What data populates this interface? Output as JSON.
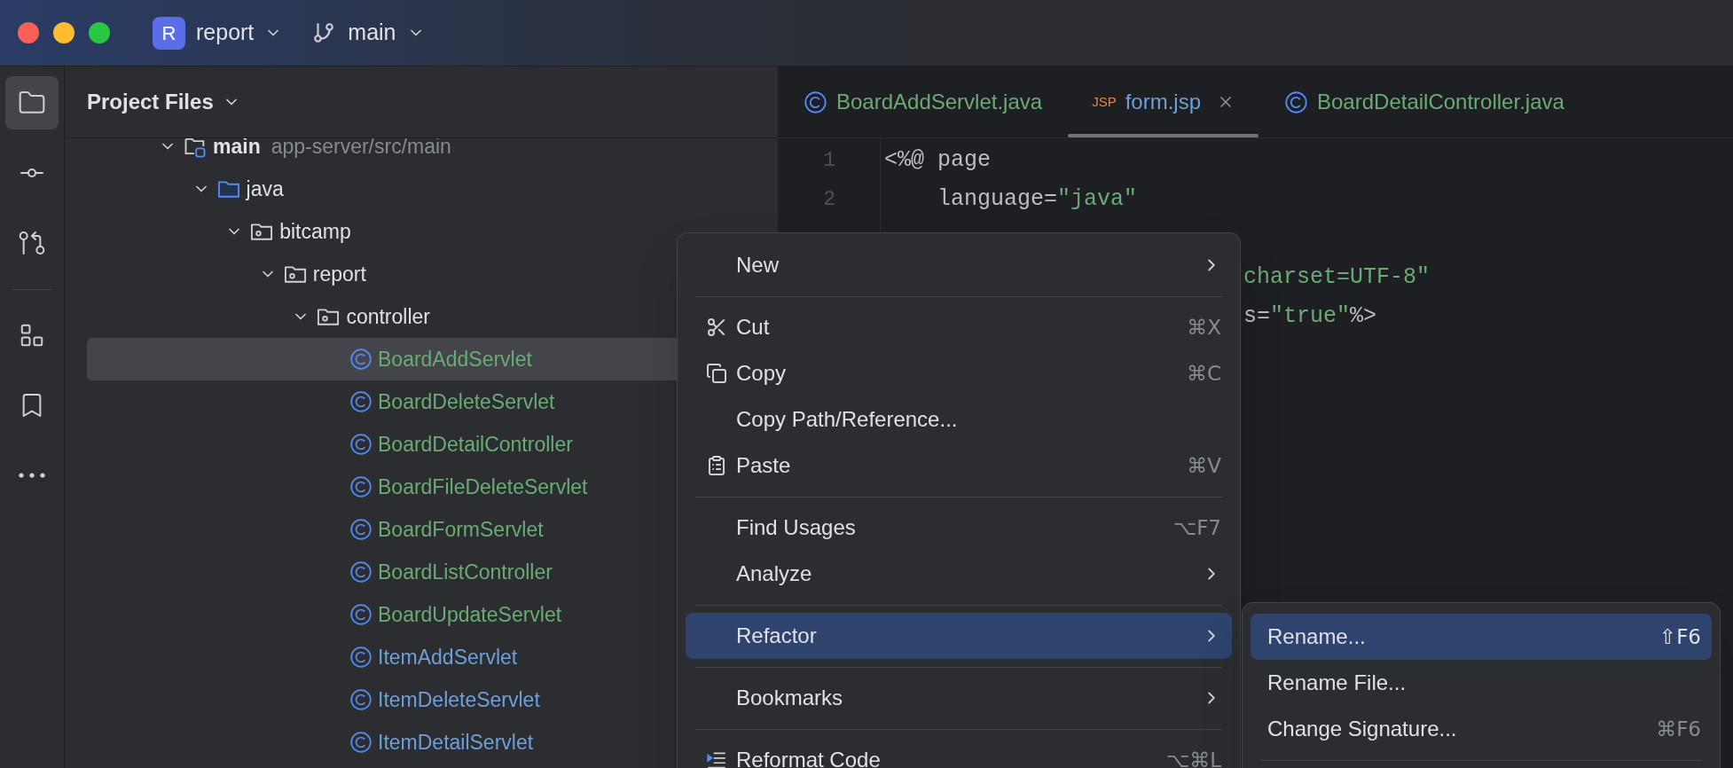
{
  "title_bar": {
    "project_badge": "R",
    "project": "report",
    "branch": "main"
  },
  "tool_groups": [
    [
      {
        "selected": true
      },
      {
        "selected": false
      },
      {
        "selected": false
      }
    ],
    [
      {
        "selected": false
      },
      {
        "selected": false
      },
      {
        "selected": false
      }
    ]
  ],
  "project_panel": {
    "title": "Project Files",
    "tree": [
      {
        "kind": "module",
        "label": "main",
        "path": "app-server/src/main",
        "expanded": true,
        "selected": false,
        "children": [
          {
            "kind": "source_root",
            "label": "java",
            "expanded": true,
            "selected": false,
            "children": [
              {
                "kind": "package",
                "label": "bitcamp",
                "expanded": true,
                "selected": false,
                "children": [
                  {
                    "kind": "package",
                    "label": "report",
                    "expanded": true,
                    "selected": false,
                    "children": [
                      {
                        "kind": "package",
                        "label": "controller",
                        "expanded": true,
                        "selected": false,
                        "children": [
                          {
                            "kind": "class",
                            "label": "BoardAddServlet",
                            "selected": true,
                            "color": "#6aab73"
                          },
                          {
                            "kind": "class",
                            "label": "BoardDeleteServlet",
                            "selected": false,
                            "color": "#6aab73"
                          },
                          {
                            "kind": "class",
                            "label": "BoardDetailController",
                            "selected": false,
                            "color": "#6aab73"
                          },
                          {
                            "kind": "class",
                            "label": "BoardFileDeleteServlet",
                            "selected": false,
                            "color": "#6aab73"
                          },
                          {
                            "kind": "class",
                            "label": "BoardFormServlet",
                            "selected": false,
                            "color": "#6aab73"
                          },
                          {
                            "kind": "class",
                            "label": "BoardListController",
                            "selected": false,
                            "color": "#6aab73"
                          },
                          {
                            "kind": "class",
                            "label": "BoardUpdateServlet",
                            "selected": false,
                            "color": "#6aab73"
                          },
                          {
                            "kind": "class",
                            "label": "ItemAddServlet",
                            "selected": false,
                            "color": "#6f9fd8"
                          },
                          {
                            "kind": "class",
                            "label": "ItemDeleteServlet",
                            "selected": false,
                            "color": "#6f9fd8"
                          },
                          {
                            "kind": "class",
                            "label": "ItemDetailServlet",
                            "selected": false,
                            "color": "#6f9fd8"
                          }
                        ]
                      }
                    ]
                  }
                ]
              }
            ]
          }
        ]
      }
    ]
  },
  "editor": {
    "tabs": [
      {
        "kind": "class",
        "label": "BoardAddServlet.java",
        "selected": false,
        "closable": false,
        "color": "#6aab73"
      },
      {
        "kind": "jsp",
        "badge": "JSP",
        "label": "form.jsp",
        "selected": true,
        "closable": true,
        "color": "#6f9fd8"
      },
      {
        "kind": "class",
        "label": "BoardDetailController.java",
        "selected": false,
        "closable": false,
        "color": "#6aab73"
      }
    ],
    "lines": [
      {
        "number": "1",
        "tokens": [
          {
            "kind": "plain",
            "text": "<%@ page"
          }
        ]
      },
      {
        "number": "2",
        "tokens": [
          {
            "kind": "plain",
            "text": "    language="
          },
          {
            "kind": "string",
            "text": "\"java\""
          }
        ]
      },
      {
        "tokens": [
          {
            "kind": "string",
            "text": "charset=UTF-8\""
          }
        ]
      },
      {
        "tokens": [
          {
            "kind": "plain",
            "text": "s="
          },
          {
            "kind": "string",
            "text": "\"true\""
          },
          {
            "kind": "plain",
            "text": "%>"
          }
        ]
      }
    ]
  },
  "context_menu": {
    "items": [
      {
        "kind": "item",
        "label": "New",
        "submenu": true,
        "selected": false
      },
      {
        "kind": "separator"
      },
      {
        "kind": "item",
        "label": "Cut",
        "shortcut": "⌘X",
        "submenu": false,
        "selected": false
      },
      {
        "kind": "item",
        "label": "Copy",
        "shortcut": "⌘C",
        "submenu": false,
        "selected": false
      },
      {
        "kind": "item",
        "label": "Copy Path/Reference...",
        "submenu": false,
        "selected": false
      },
      {
        "kind": "item",
        "label": "Paste",
        "shortcut": "⌘V",
        "submenu": false,
        "selected": false
      },
      {
        "kind": "separator"
      },
      {
        "kind": "item",
        "label": "Find Usages",
        "shortcut": "⌥F7",
        "submenu": false,
        "selected": false
      },
      {
        "kind": "item",
        "label": "Analyze",
        "submenu": true,
        "selected": false
      },
      {
        "kind": "separator"
      },
      {
        "kind": "item",
        "label": "Refactor",
        "submenu": true,
        "selected": true
      },
      {
        "kind": "separator"
      },
      {
        "kind": "item",
        "label": "Bookmarks",
        "submenu": true,
        "selected": false
      },
      {
        "kind": "separator"
      },
      {
        "kind": "item",
        "label": "Reformat Code",
        "shortcut": "⌥⌘L",
        "submenu": false,
        "selected": false
      }
    ]
  },
  "submenu": {
    "items": [
      {
        "kind": "item",
        "label": "Rename...",
        "shortcut": "⇧F6",
        "selected": true
      },
      {
        "kind": "item",
        "label": "Rename File...",
        "selected": false
      },
      {
        "kind": "item",
        "label": "Change Signature...",
        "shortcut": "⌘F6",
        "selected": false
      },
      {
        "kind": "separator"
      }
    ]
  }
}
